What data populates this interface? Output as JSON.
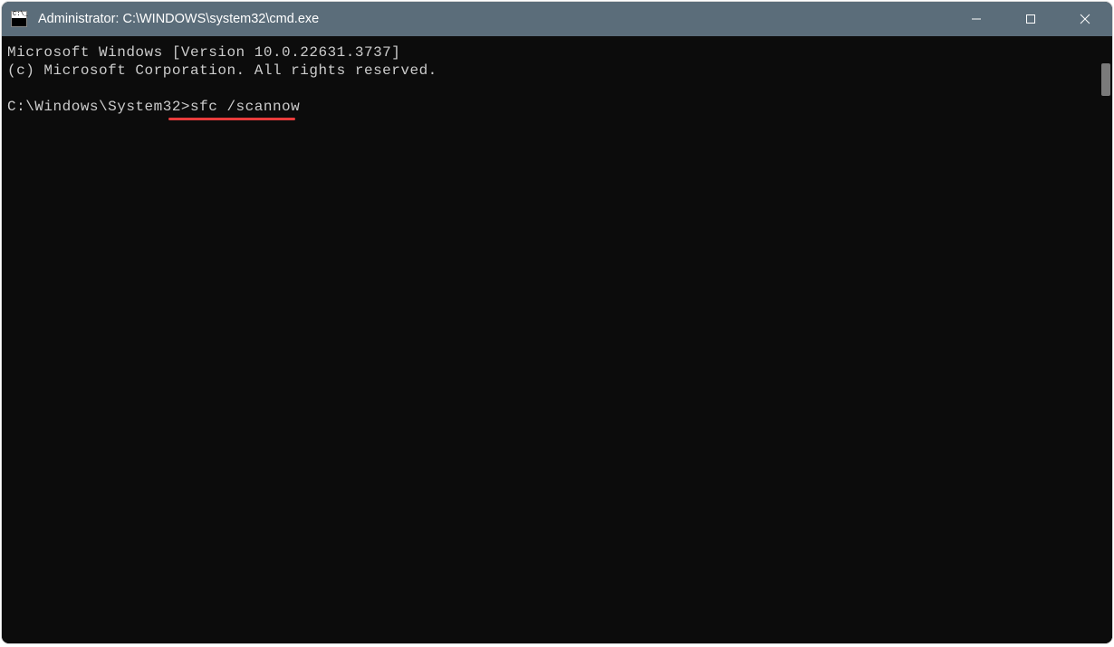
{
  "window": {
    "title": "Administrator: C:\\WINDOWS\\system32\\cmd.exe",
    "icon": "cmd-icon"
  },
  "terminal": {
    "line1": "Microsoft Windows [Version 10.0.22631.3737]",
    "line2": "(c) Microsoft Corporation. All rights reserved.",
    "blank": "",
    "prompt": "C:\\Windows\\System32>",
    "command": "sfc /scannow"
  },
  "annotation": {
    "underline_color": "#e83c3c"
  }
}
